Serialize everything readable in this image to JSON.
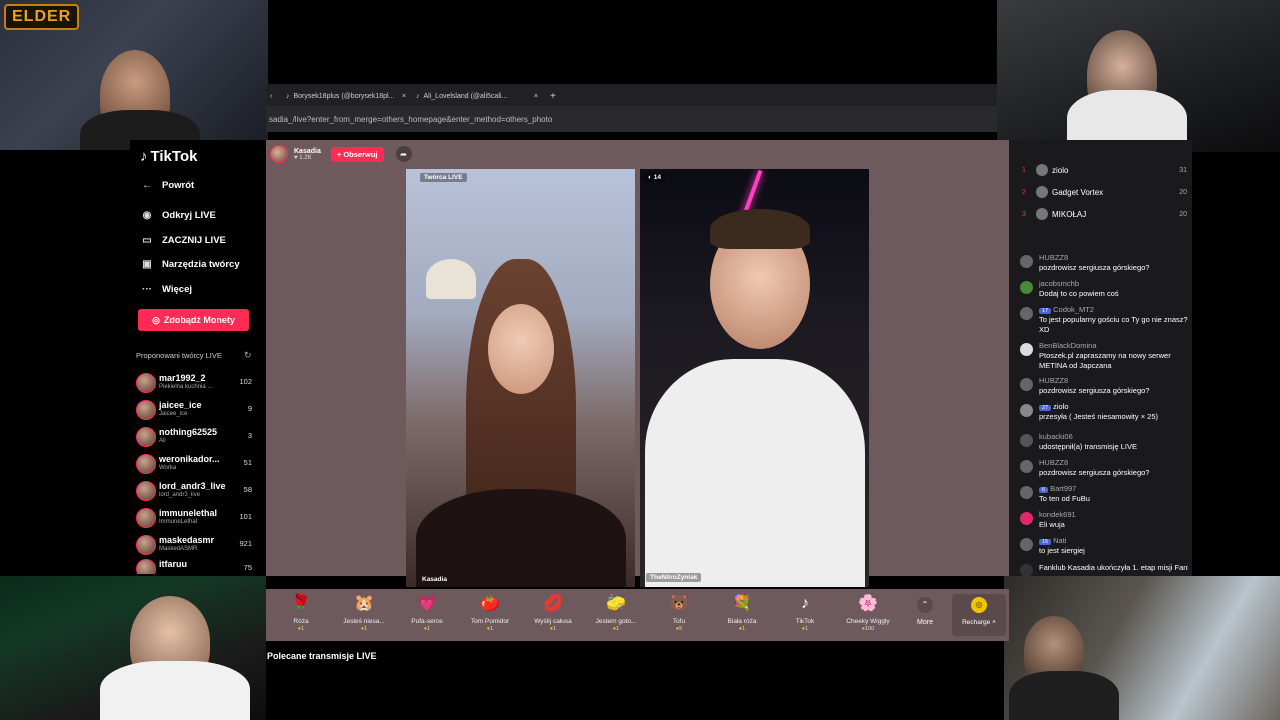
{
  "stream": {
    "logo_text": "ELDER"
  },
  "browser": {
    "tabs": [
      {
        "label": "Borysek18plus (@borysek18pl..."
      },
      {
        "label": "Ali_Lovelsland (@ali5cali..."
      }
    ],
    "new_tab": "+",
    "url": "sadia_/live?enter_from_merge=others_homepage&enter_method=others_photo"
  },
  "nav": {
    "logo": "TikTok",
    "back": "Powrót",
    "items": [
      {
        "label": "Odkryj LIVE",
        "icon": "live-icon"
      },
      {
        "label": "ZACZNIJ LIVE",
        "icon": "camera-icon"
      },
      {
        "label": "Narzędzia twórcy",
        "icon": "tools-icon"
      },
      {
        "label": "Więcej",
        "icon": "more-icon"
      }
    ],
    "coins_button": "Zdobądź Monety",
    "suggested_title": "Proponowani twórcy LIVE",
    "creators": [
      {
        "name": "mar1992_2",
        "sub": "Piekielna kuchnia ...",
        "count": "102"
      },
      {
        "name": "jaicee_ice",
        "sub": "Jaicee_ice",
        "count": "9"
      },
      {
        "name": "nothing62525",
        "sub": "Ali",
        "count": "3"
      },
      {
        "name": "weronikador...",
        "sub": "Worka",
        "count": "51"
      },
      {
        "name": "lord_andr3_live",
        "sub": "lord_andr3_live",
        "count": "58"
      },
      {
        "name": "immunelethal",
        "sub": "ImmuneLethal",
        "count": "101"
      },
      {
        "name": "maskedasmr",
        "sub": "MaskedASMR",
        "count": "921"
      },
      {
        "name": "itfaruu",
        "sub": "",
        "count": "75"
      }
    ]
  },
  "live": {
    "host_name": "Kasadia",
    "host_likes": "1.2K",
    "follow_label": "+ Obserwuj",
    "left_tag": "Twórca LIVE",
    "left_name": "Kasadia",
    "right_tag": "14",
    "right_name": "TheNitroZyniak"
  },
  "gifts": [
    {
      "name": "Róża",
      "price": "1",
      "icon": "🌹"
    },
    {
      "name": "Jesteś niesa...",
      "price": "1",
      "icon": "🐹"
    },
    {
      "name": "Pufa-serce",
      "price": "1",
      "icon": "💗"
    },
    {
      "name": "Tom Pomidor",
      "price": "1",
      "icon": "🍅"
    },
    {
      "name": "Wyślij całusa",
      "price": "1",
      "icon": "💋"
    },
    {
      "name": "Jestem goto...",
      "price": "1",
      "icon": "🧽"
    },
    {
      "name": "Tofu",
      "price": "5",
      "icon": "🐻"
    },
    {
      "name": "Biała róża",
      "price": "1",
      "icon": "💐"
    },
    {
      "name": "TikTok",
      "price": "1",
      "icon": "♪"
    },
    {
      "name": "Cheeky Wiggly",
      "price": "100",
      "icon": "🌸"
    }
  ],
  "more_label": "More",
  "recharge_label": "Recharge",
  "recommended_title": "Polecane transmisje LIVE",
  "chat": {
    "top_viewers": [
      {
        "rank": "1",
        "name": "ziolo",
        "score": "31"
      },
      {
        "rank": "2",
        "name": "Gadget Vortex",
        "score": "20"
      },
      {
        "rank": "3",
        "name": "MIKOŁAJ",
        "score": "20"
      }
    ],
    "messages": [
      {
        "user": "HUBZZ8",
        "badge": "",
        "text": "pozdrowisz sergiusza górskiego?"
      },
      {
        "user": "jacobsmchb",
        "badge": "",
        "text": "Dodaj to co powiem coś"
      },
      {
        "user": "Codok_MT2",
        "badge": "17",
        "text": "To jest popularny gościu co Ty go nie znasz? XD"
      },
      {
        "user": "BenBlackDomina",
        "badge": "",
        "text": "Ptoszek.pl zapraszamy na nowy serwer METINA od Japczana"
      },
      {
        "user": "HUBZZ8",
        "badge": "",
        "text": "pozdrowisz sergiusza górskiego?"
      },
      {
        "user": "ziolo",
        "badge": "27",
        "text": "przesyła ( Jesteś niesamowity × 25)"
      },
      {
        "user": "kubacki06",
        "badge": "",
        "text": "udostępnił(a) transmisję LIVE"
      },
      {
        "user": "HUBZZ8",
        "badge": "",
        "text": "pozdrowisz sergiusza górskiego?"
      },
      {
        "user": "Bart997",
        "badge": "6",
        "text": "To ten od FuBu"
      },
      {
        "user": "kondek691",
        "badge": "",
        "text": "Eli wuja"
      },
      {
        "user": "Nati",
        "badge": "15",
        "text": "to jest siergiej"
      },
      {
        "user": "",
        "badge": "",
        "text": "Fanklub Kasadia ukończyła 1. etap misji Fanklubu"
      }
    ]
  }
}
